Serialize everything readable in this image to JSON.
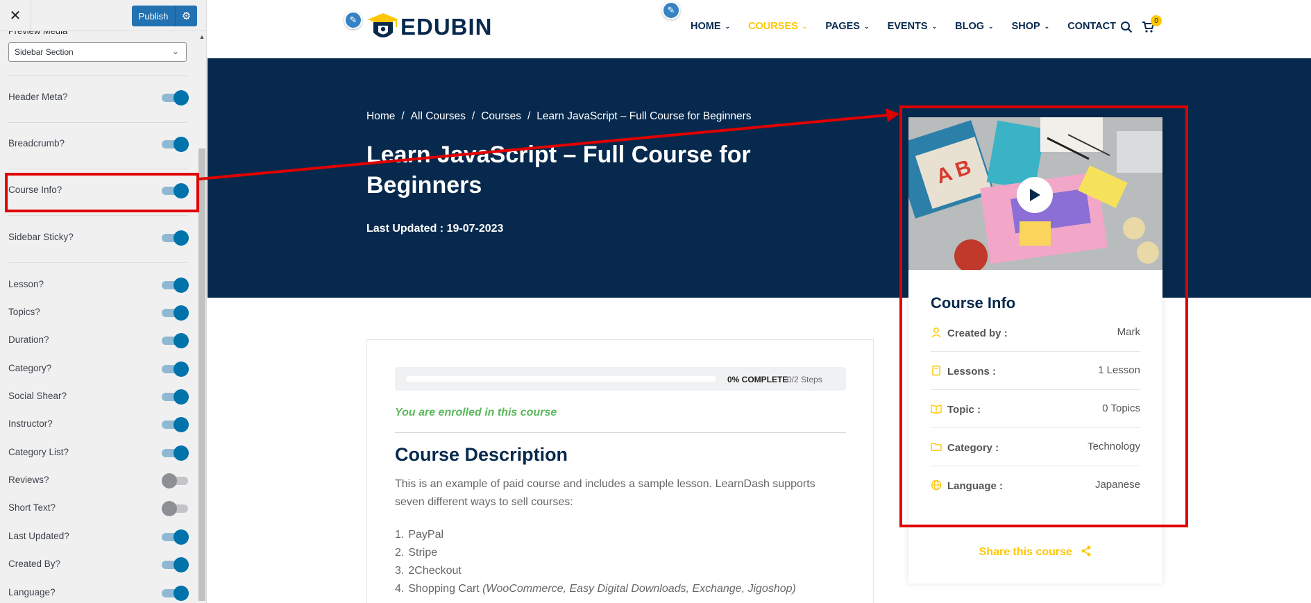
{
  "sidebar": {
    "close_label": "✕",
    "publish_label": "Publish",
    "preview_label": "Preview Media",
    "preview_value": "Sidebar Section",
    "toggles": [
      {
        "label": "Header Meta?",
        "on": true
      },
      {
        "label": "Breadcrumb?",
        "on": true
      },
      {
        "label": "Course Info?",
        "on": true
      },
      {
        "label": "Sidebar Sticky?",
        "on": true
      },
      {
        "label": "Lesson?",
        "on": true
      },
      {
        "label": "Topics?",
        "on": true
      },
      {
        "label": "Duration?",
        "on": true
      },
      {
        "label": "Category?",
        "on": true
      },
      {
        "label": "Social Shear?",
        "on": true
      },
      {
        "label": "Instructor?",
        "on": true
      },
      {
        "label": "Category List?",
        "on": true
      },
      {
        "label": "Reviews?",
        "on": false
      },
      {
        "label": "Short Text?",
        "on": false
      },
      {
        "label": "Last Updated?",
        "on": true
      },
      {
        "label": "Created By?",
        "on": true
      },
      {
        "label": "Language?",
        "on": true
      }
    ]
  },
  "header": {
    "logo_text": "EDUBIN",
    "nav": [
      {
        "label": "HOME",
        "dropdown": true,
        "active": false
      },
      {
        "label": "COURSES",
        "dropdown": true,
        "active": true
      },
      {
        "label": "PAGES",
        "dropdown": true,
        "active": false
      },
      {
        "label": "EVENTS",
        "dropdown": true,
        "active": false
      },
      {
        "label": "BLOG",
        "dropdown": true,
        "active": false
      },
      {
        "label": "SHOP",
        "dropdown": true,
        "active": false
      },
      {
        "label": "CONTACT",
        "dropdown": false,
        "active": false
      }
    ],
    "cart_count": "0"
  },
  "hero": {
    "breadcrumb": [
      "Home",
      "All Courses",
      "Courses",
      "Learn JavaScript – Full Course for Beginners"
    ],
    "title": "Learn JavaScript – Full Course for Beginners",
    "last_updated": "Last Updated : 19-07-2023"
  },
  "course_info": {
    "heading": "Course Info",
    "rows": [
      {
        "icon": "user-icon",
        "key": "Created by :",
        "value": "Mark"
      },
      {
        "icon": "book-icon",
        "key": "Lessons :",
        "value": "1 Lesson"
      },
      {
        "icon": "open-book-icon",
        "key": "Topic :",
        "value": "0 Topics"
      },
      {
        "icon": "folder-icon",
        "key": "Category :",
        "value": "Technology"
      },
      {
        "icon": "globe-icon",
        "key": "Language :",
        "value": "Japanese"
      }
    ],
    "share_label": "Share this course"
  },
  "content": {
    "progress_fraction": 0,
    "progress_pct_label": "0% COMPLETE",
    "progress_steps": "0/2 Steps",
    "enrolled": "You are enrolled in this course",
    "desc_heading": "Course Description",
    "desc_text": "This is an example of paid course and includes a sample lesson.  LearnDash supports seven different ways to sell courses:",
    "payment_methods": [
      {
        "num": "1.",
        "name": "PayPal",
        "note": ""
      },
      {
        "num": "2.",
        "name": "Stripe",
        "note": ""
      },
      {
        "num": "3.",
        "name": "2Checkout",
        "note": ""
      },
      {
        "num": "4.",
        "name": "Shopping Cart",
        "note": "(WooCommerce, Easy Digital Downloads, Exchange, Jigoshop)"
      }
    ]
  },
  "colors": {
    "brand_navy": "#07294d",
    "accent_yellow": "#ffc600",
    "wp_blue": "#2271b1",
    "annotation_red": "#e00000",
    "enrolled_green": "#5cb85c"
  }
}
